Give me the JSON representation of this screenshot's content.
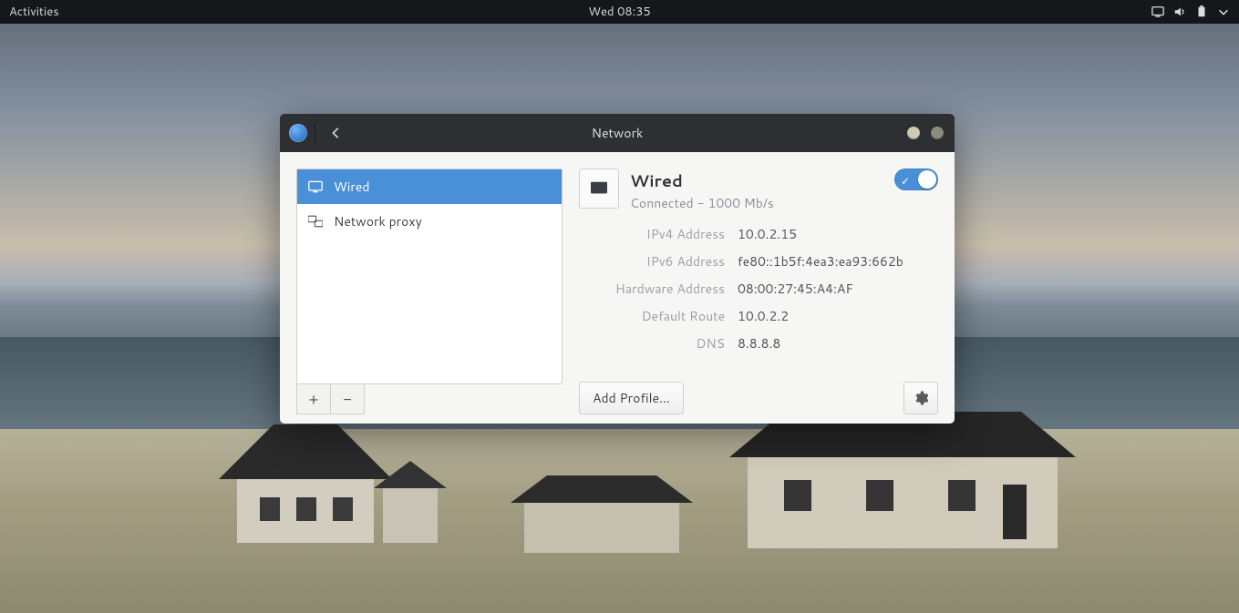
{
  "topbar": {
    "activities": "Activities",
    "clock": "Wed 08:35"
  },
  "window": {
    "title": "Network"
  },
  "sidebar": {
    "items": [
      {
        "label": "Wired"
      },
      {
        "label": "Network proxy"
      }
    ],
    "add": "+",
    "remove": "−"
  },
  "content": {
    "heading": "Wired",
    "status": "Connected - 1000 Mb/s",
    "toggle_on": true,
    "details": [
      {
        "k": "IPv4 Address",
        "v": "10.0.2.15"
      },
      {
        "k": "IPv6 Address",
        "v": "fe80::1b5f:4ea3:ea93:662b"
      },
      {
        "k": "Hardware Address",
        "v": "08:00:27:45:A4:AF"
      },
      {
        "k": "Default Route",
        "v": "10.0.2.2"
      },
      {
        "k": "DNS",
        "v": "8.8.8.8"
      }
    ],
    "add_profile": "Add Profile…"
  }
}
